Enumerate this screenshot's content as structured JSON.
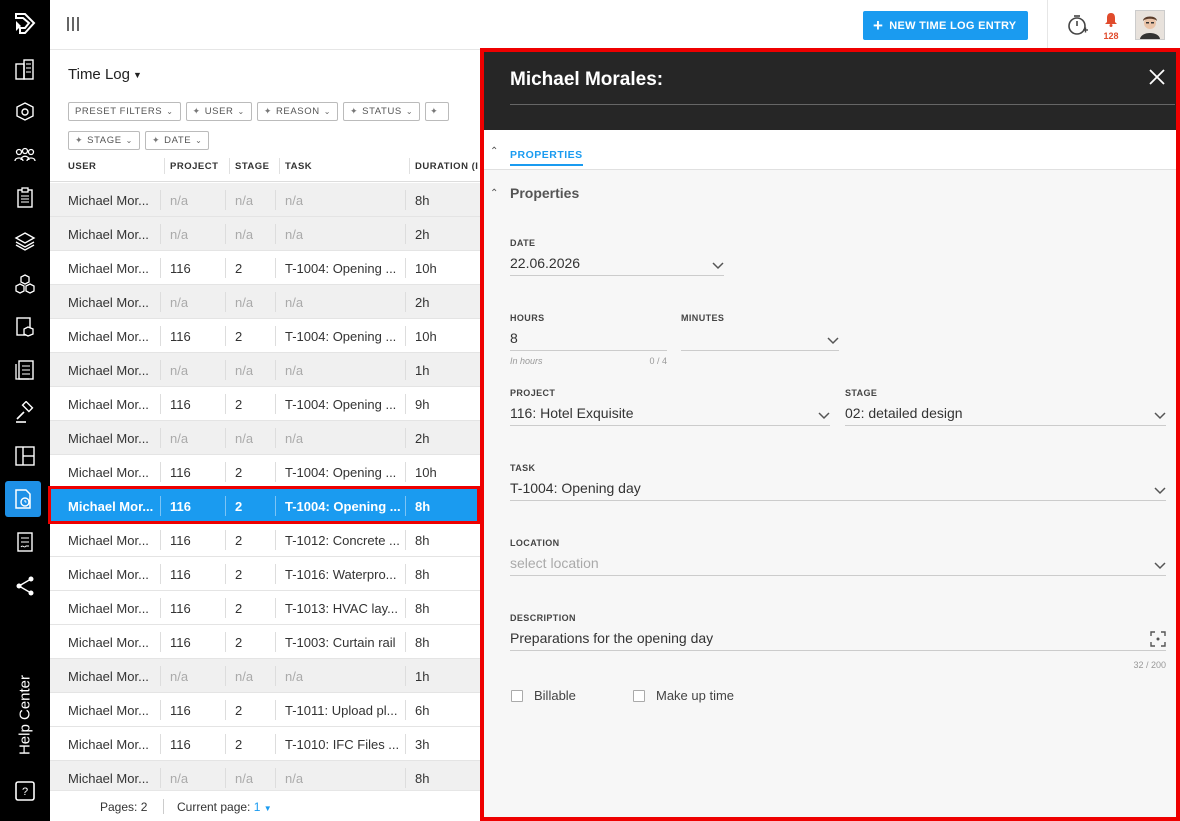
{
  "topbar": {
    "new_entry_label": "NEW TIME LOG ENTRY",
    "notification_count": "128"
  },
  "rail": {
    "icons": [
      "buildings-icon",
      "settings-cube-icon",
      "team-icon",
      "clipboard-icon",
      "layers-icon",
      "cubes-icon",
      "document-cube-icon",
      "document-list-icon",
      "gavel-icon",
      "layout-icon",
      "time-log-icon",
      "contract-icon",
      "share-icon"
    ],
    "active": "time-log-icon",
    "help_label": "Help Center"
  },
  "list": {
    "view_title": "Time Log",
    "filters": [
      "PRESET FILTERS",
      "USER",
      "REASON",
      "STATUS",
      "STAGE",
      "DATE"
    ],
    "columns": [
      "USER",
      "PROJECT",
      "STAGE",
      "TASK",
      "DURATION (I"
    ],
    "rows": [
      {
        "user": "Michael Mor...",
        "project": "n/a",
        "stage": "n/a",
        "task": "n/a",
        "duration": "8h"
      },
      {
        "user": "Michael Mor...",
        "project": "n/a",
        "stage": "n/a",
        "task": "n/a",
        "duration": "2h"
      },
      {
        "user": "Michael Mor...",
        "project": "116",
        "stage": "2",
        "task": "T-1004: Opening ...",
        "duration": "10h"
      },
      {
        "user": "Michael Mor...",
        "project": "n/a",
        "stage": "n/a",
        "task": "n/a",
        "duration": "2h"
      },
      {
        "user": "Michael Mor...",
        "project": "116",
        "stage": "2",
        "task": "T-1004: Opening ...",
        "duration": "10h"
      },
      {
        "user": "Michael Mor...",
        "project": "n/a",
        "stage": "n/a",
        "task": "n/a",
        "duration": "1h"
      },
      {
        "user": "Michael Mor...",
        "project": "116",
        "stage": "2",
        "task": "T-1004: Opening ...",
        "duration": "9h"
      },
      {
        "user": "Michael Mor...",
        "project": "n/a",
        "stage": "n/a",
        "task": "n/a",
        "duration": "2h"
      },
      {
        "user": "Michael Mor...",
        "project": "116",
        "stage": "2",
        "task": "T-1004: Opening ...",
        "duration": "10h"
      },
      {
        "user": "Michael Mor...",
        "project": "116",
        "stage": "2",
        "task": "T-1004: Opening ...",
        "duration": "8h"
      },
      {
        "user": "Michael Mor...",
        "project": "116",
        "stage": "2",
        "task": "T-1012: Concrete ...",
        "duration": "8h"
      },
      {
        "user": "Michael Mor...",
        "project": "116",
        "stage": "2",
        "task": "T-1016: Waterpro...",
        "duration": "8h"
      },
      {
        "user": "Michael Mor...",
        "project": "116",
        "stage": "2",
        "task": "T-1013: HVAC lay...",
        "duration": "8h"
      },
      {
        "user": "Michael Mor...",
        "project": "116",
        "stage": "2",
        "task": "T-1003: Curtain rail",
        "duration": "8h"
      },
      {
        "user": "Michael Mor...",
        "project": "n/a",
        "stage": "n/a",
        "task": "n/a",
        "duration": "1h"
      },
      {
        "user": "Michael Mor...",
        "project": "116",
        "stage": "2",
        "task": "T-1011: Upload pl...",
        "duration": "6h"
      },
      {
        "user": "Michael Mor...",
        "project": "116",
        "stage": "2",
        "task": "T-1010: IFC Files ...",
        "duration": "3h"
      },
      {
        "user": "Michael Mor...",
        "project": "n/a",
        "stage": "n/a",
        "task": "n/a",
        "duration": "8h"
      }
    ],
    "selected_index": 9,
    "pager": {
      "pages_label": "Pages: 2",
      "current_label": "Current page:",
      "current_value": "1"
    }
  },
  "panel": {
    "title": "Michael Morales:",
    "tab": "PROPERTIES",
    "section_title": "Properties",
    "date": {
      "label": "DATE",
      "value": "22.06.2026"
    },
    "hours": {
      "label": "HOURS",
      "value": "8",
      "hint": "In hours",
      "count": "0 / 4"
    },
    "minutes": {
      "label": "MINUTES",
      "value": ""
    },
    "project": {
      "label": "PROJECT",
      "value": "116: Hotel Exquisite"
    },
    "stage": {
      "label": "STAGE",
      "value": "02: detailed design"
    },
    "task": {
      "label": "TASK",
      "value": "T-1004: Opening day"
    },
    "location": {
      "label": "LOCATION",
      "placeholder": "select location"
    },
    "description": {
      "label": "DESCRIPTION",
      "value": "Preparations for the opening day",
      "count": "32 / 200"
    },
    "billable_label": "Billable",
    "makeup_label": "Make up time"
  }
}
